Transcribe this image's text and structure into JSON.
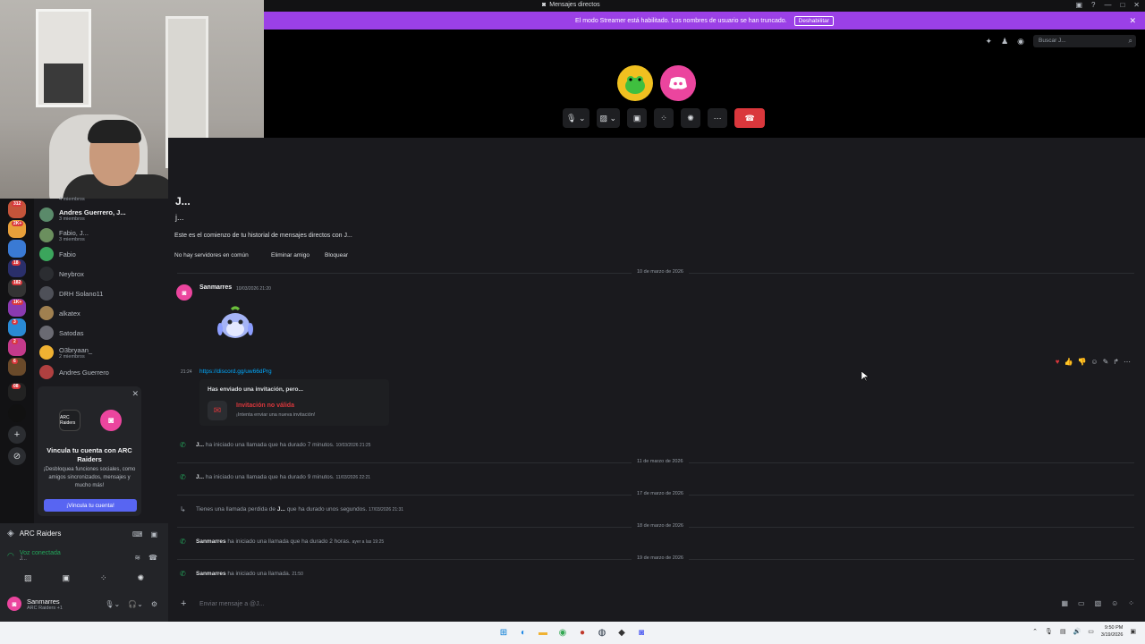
{
  "window": {
    "title": "Mensajes directos"
  },
  "streamer_banner": {
    "message": "El modo Streamer está habilitado. Los nombres de usuario se han truncado.",
    "button": "Deshabilitar"
  },
  "search": {
    "placeholder": "Buscar J..."
  },
  "dm_list": [
    {
      "name": "Andres Guerrero, J...",
      "sub": "3 miembros",
      "color": "#5a8a6a",
      "active": true
    },
    {
      "name": "Fabio, J...",
      "sub": "3 miembros",
      "color": "#6b8f5e"
    },
    {
      "name": "Fabio",
      "sub": "",
      "color": "#3ba55c"
    },
    {
      "name": "Neybrox",
      "sub": "",
      "color": "#2b2d31"
    },
    {
      "name": "DRH Solano11",
      "sub": "",
      "color": "#4e5058"
    },
    {
      "name": "alkatex",
      "sub": "",
      "color": "#a08050"
    },
    {
      "name": "Satodas",
      "sub": "",
      "color": "#6a6a72"
    },
    {
      "name": "O3bryaan_",
      "sub": "2 miembros",
      "color": "#f0b232"
    },
    {
      "name": "Andres Guerrero",
      "sub": "",
      "color": "#b04040"
    }
  ],
  "dm_list_top_sub": "4 miembros",
  "promo": {
    "logo_text": "ARC Raiders",
    "title": "Vincula tu cuenta con ARC Raiders",
    "description": "¡Desbloquea funciones sociales, como amigos sincronizados, mensajes y mucho más!",
    "cta": "¡Vincula tu cuenta!"
  },
  "user_panel": {
    "game": "ARC Raiders",
    "voice_status": "Voz conectada",
    "voice_sub": "J...",
    "username": "Sanmarres",
    "user_status": "ARC Raiders +1"
  },
  "chat": {
    "header_name": "J...",
    "header_sub": "j...",
    "intro": "Este es el comienzo de tu historial de mensajes directos con J...",
    "no_servers": "No hay servidores en común",
    "remove_friend": "Eliminar amigo",
    "block": "Bloquear",
    "dates": [
      "10 de marzo de 2026",
      "11 de marzo de 2026",
      "17 de marzo de 2026",
      "18 de marzo de 2026",
      "19 de marzo de 2026"
    ],
    "message": {
      "author": "Sanmarres",
      "timestamp": "10/03/2026 21:20",
      "time_short": "21:24",
      "link": "https://discord.gg/uw66dPrg",
      "invite_heading": "Has enviado una invitación, pero...",
      "invite_invalid": "Invitación no válida",
      "invite_hint": "¡Intenta enviar una nueva invitación!"
    },
    "calls": [
      {
        "who": "J...",
        "text": "ha iniciado una llamada que ha durado 7 minutos.",
        "ts": "10/03/2026 21:25",
        "missed": false
      },
      {
        "who": "J...",
        "text": "ha iniciado una llamada que ha durado 9 minutos.",
        "ts": "11/03/2026 22:21",
        "missed": false
      },
      {
        "who": "",
        "text": "Tienes una llamada perdida de",
        "who2": "J...",
        "text2": "que ha durado unos segundos.",
        "ts": "17/03/2026 21:31",
        "missed": true
      },
      {
        "who": "Sanmarres",
        "text": "ha iniciado una llamada que ha durado 2 horas.",
        "ts": "ayer a las 19:25",
        "missed": false
      },
      {
        "who": "Sanmarres",
        "text": "ha iniciado una llamada.",
        "ts": "21:50",
        "missed": false
      }
    ],
    "composer_placeholder": "Enviar mensaje a @J..."
  },
  "server_badges": [
    "312",
    "2K+",
    "18",
    "182",
    "1K+",
    "3",
    "2",
    "6",
    "08"
  ],
  "taskbar": {
    "time": "9:50 PM",
    "date": "3/19/2026"
  },
  "colors": {
    "accent": "#5865f2",
    "streamer": "#9b40e6",
    "danger": "#da373c",
    "online": "#23a55a",
    "pink": "#eb459e"
  }
}
